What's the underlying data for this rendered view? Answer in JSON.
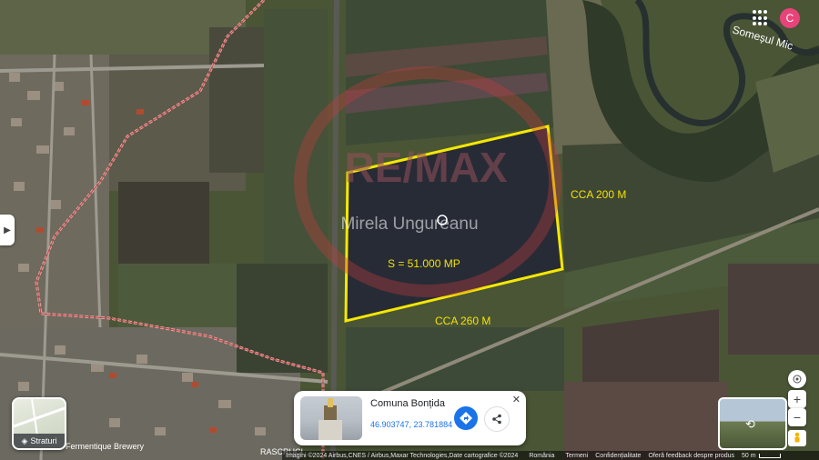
{
  "map": {
    "river_label": "Someșul Mic",
    "parcel_width_label": "CCA 200 M",
    "parcel_length_label": "CCA 260 M",
    "parcel_area_label": "S = 51.000 MP",
    "watermark_brand": "RE/MAX",
    "watermark_agent": "Mirela Ungureanu",
    "place_labels": [
      "Fermentique Brewery",
      "RASCRUCI"
    ],
    "colors": {
      "parcel_outline": "#f5e800",
      "annotation_text": "#f2e200",
      "boundary": "#e8a0a0"
    }
  },
  "top_right": {
    "avatar_letter": "C",
    "apps_icon": "grid-apps-icon"
  },
  "layers_button": {
    "label": "Straturi"
  },
  "place_card": {
    "title": "Comuna Bonțida",
    "coordinates": "46.903747, 23.781884",
    "directions_icon": "directions-icon",
    "share_icon": "share-icon",
    "close_icon": "close-icon"
  },
  "controls": {
    "zoom_in": "+",
    "zoom_out": "−"
  },
  "footer": {
    "imagery": "Imagini ©2024 Airbus,CNES / Airbus,Maxar Technologies,Date cartografice ©2024",
    "country": "România",
    "terms": "Termeni",
    "privacy": "Confidențialitate",
    "feedback": "Oferă feedback despre produs",
    "scale": "50 m"
  }
}
